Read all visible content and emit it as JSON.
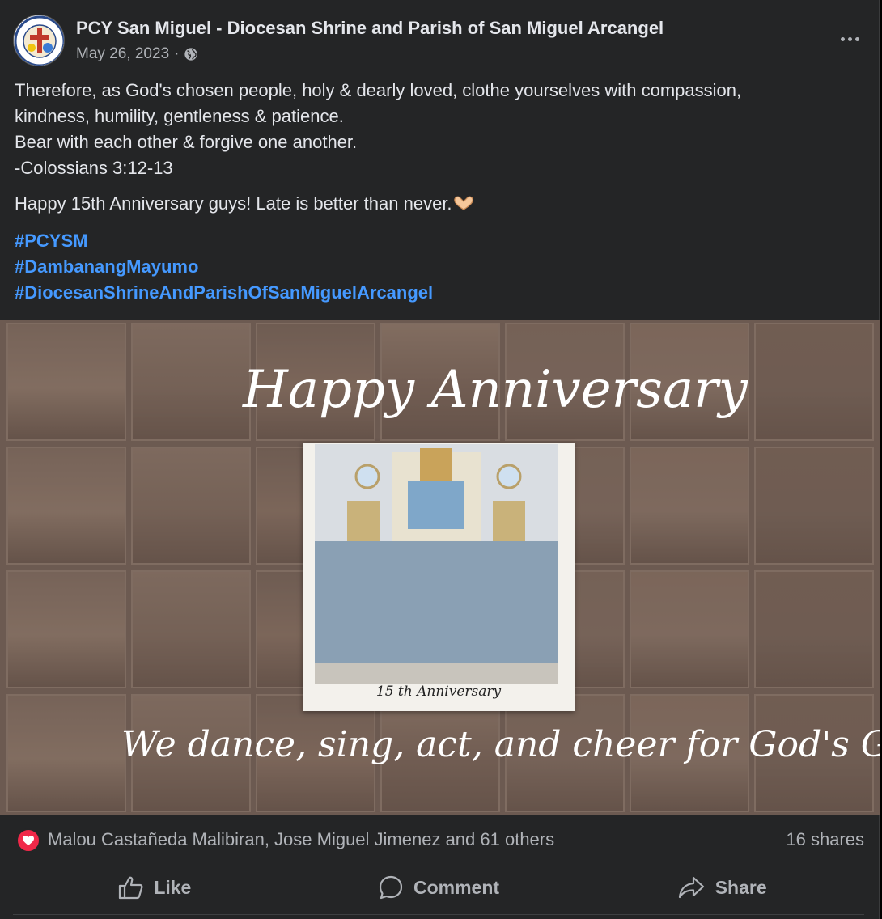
{
  "post": {
    "page_name": "PCY San Miguel - Diocesan Shrine and Parish of San Miguel Arcangel",
    "date": "May 26, 2023",
    "separator": "·",
    "privacy_icon": "globe-icon",
    "more_icon": "more-options-icon",
    "text_lines": [
      "Therefore, as God's chosen people, holy & dearly loved, clothe yourselves with compassion,",
      "kindness, humility, gentleness & patience.",
      "Bear with each other & forgive one another.",
      "-Colossians 3:12-13"
    ],
    "anniversary_line": "Happy 15th Anniversary guys! Late is better than never.",
    "emoji_icon": "heart-hands-icon",
    "hashtags": [
      "#PCYSM",
      "#DambanangMayumo",
      "#DiocesanShrineAndParishOfSanMiguelArcangel"
    ]
  },
  "image": {
    "heading": "Happy Anniversary",
    "polaroid_caption": "15 th   Anniversary",
    "tagline": "We dance, sing, act, and cheer for God's Glory!"
  },
  "reactions": {
    "icon": "love-reaction-icon",
    "names": "Malou Castañeda Malibiran, Jose Miguel Jimenez and 61 others",
    "shares": "16 shares"
  },
  "actions": {
    "like": "Like",
    "comment": "Comment",
    "share": "Share"
  },
  "colors": {
    "background": "#242526",
    "text": "#e4e6eb",
    "muted": "#b0b3b8",
    "hashtag": "#4599ff",
    "love": "#f02849"
  }
}
